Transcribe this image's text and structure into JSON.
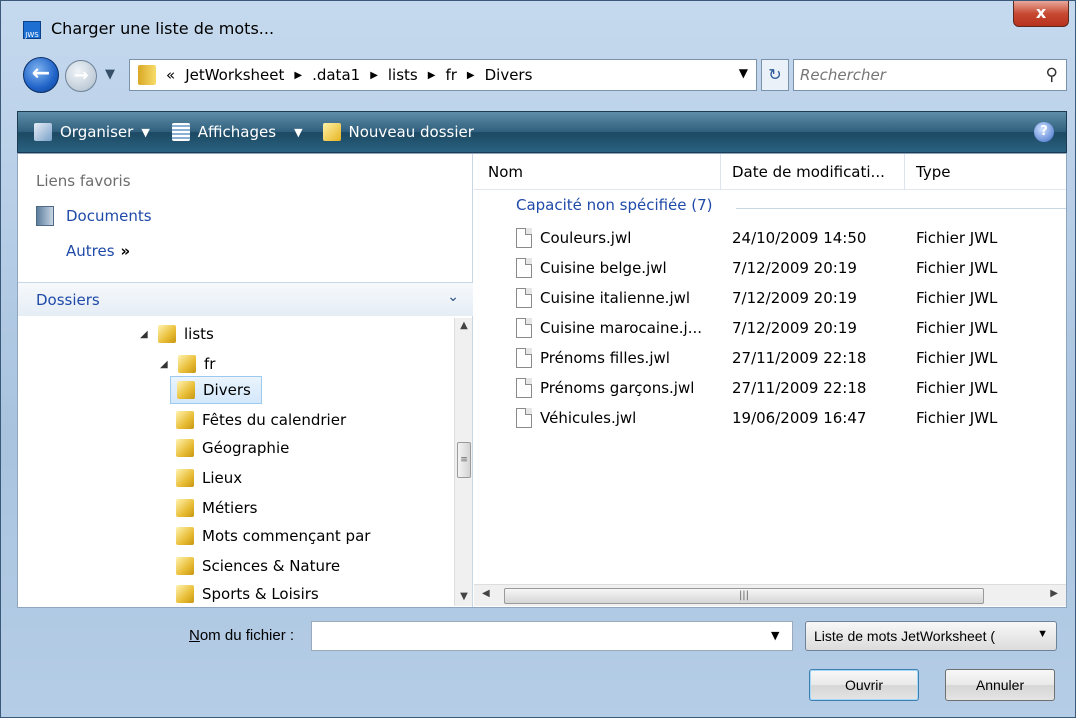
{
  "window": {
    "title": "Charger une liste de mots...",
    "app_icon_text": "JWS",
    "close_label": "x"
  },
  "nav": {
    "breadcrumb_prefix": "«",
    "breadcrumbs": [
      "JetWorksheet",
      ".data1",
      "lists",
      "fr",
      "Divers"
    ],
    "search_placeholder": "Rechercher"
  },
  "toolbar": {
    "organise": "Organiser",
    "views": "Affichages",
    "new_folder": "Nouveau dossier",
    "help": "?"
  },
  "left_pane": {
    "favorites_header": "Liens favoris",
    "favorites": [
      "Documents"
    ],
    "more_label": "Autres",
    "folders_header": "Dossiers",
    "tree": [
      {
        "label": "lists",
        "level": 0,
        "expanded": true
      },
      {
        "label": "fr",
        "level": 1,
        "expanded": true
      },
      {
        "label": "Divers",
        "level": 2,
        "selected": true
      },
      {
        "label": "Fêtes du calendrier",
        "level": 2
      },
      {
        "label": "Géographie",
        "level": 2
      },
      {
        "label": "Lieux",
        "level": 2
      },
      {
        "label": "Métiers",
        "level": 2
      },
      {
        "label": "Mots commençant par",
        "level": 2
      },
      {
        "label": "Sciences & Nature",
        "level": 2
      },
      {
        "label": "Sports & Loisirs",
        "level": 2
      }
    ]
  },
  "file_list": {
    "columns": [
      "Nom",
      "Date de modificati...",
      "Type"
    ],
    "group_header": "Capacité non spécifiée (7)",
    "files": [
      {
        "name": "Couleurs.jwl",
        "date": "24/10/2009 14:50",
        "type": "Fichier JWL"
      },
      {
        "name": "Cuisine belge.jwl",
        "date": "7/12/2009 20:19",
        "type": "Fichier JWL"
      },
      {
        "name": "Cuisine italienne.jwl",
        "date": "7/12/2009 20:19",
        "type": "Fichier JWL"
      },
      {
        "name": "Cuisine marocaine.j...",
        "date": "7/12/2009 20:19",
        "type": "Fichier JWL"
      },
      {
        "name": "Prénoms filles.jwl",
        "date": "27/11/2009 22:18",
        "type": "Fichier JWL"
      },
      {
        "name": "Prénoms garçons.jwl",
        "date": "27/11/2009 22:18",
        "type": "Fichier JWL"
      },
      {
        "name": "Véhicules.jwl",
        "date": "19/06/2009 16:47",
        "type": "Fichier JWL"
      }
    ]
  },
  "bottom": {
    "filename_label": "Nom du fichier :",
    "filename_value": "",
    "filetype_selected": "Liste de mots JetWorksheet (",
    "open_label": "Ouvrir",
    "cancel_label": "Annuler"
  }
}
